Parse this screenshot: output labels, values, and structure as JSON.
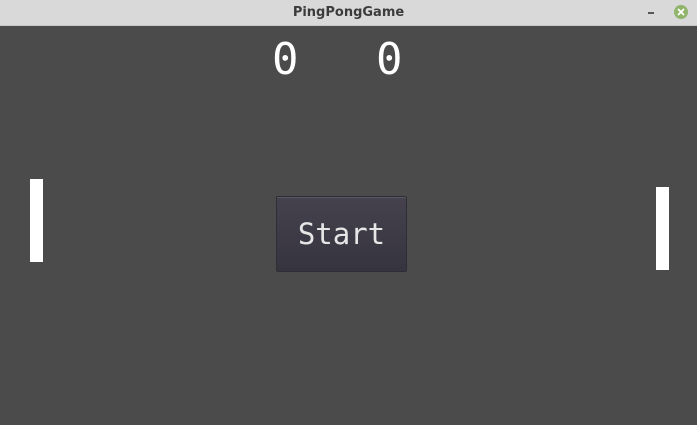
{
  "window": {
    "title": "PingPongGame"
  },
  "scores": {
    "left": "0",
    "right": "0"
  },
  "controls": {
    "start_label": "Start"
  },
  "icons": {
    "minimize": "minimize-icon",
    "close": "close-icon"
  },
  "colors": {
    "background": "#4b4b4b",
    "paddle": "#ffffff",
    "titlebar": "#d9d9d9",
    "close_button": "#8fb46a"
  }
}
